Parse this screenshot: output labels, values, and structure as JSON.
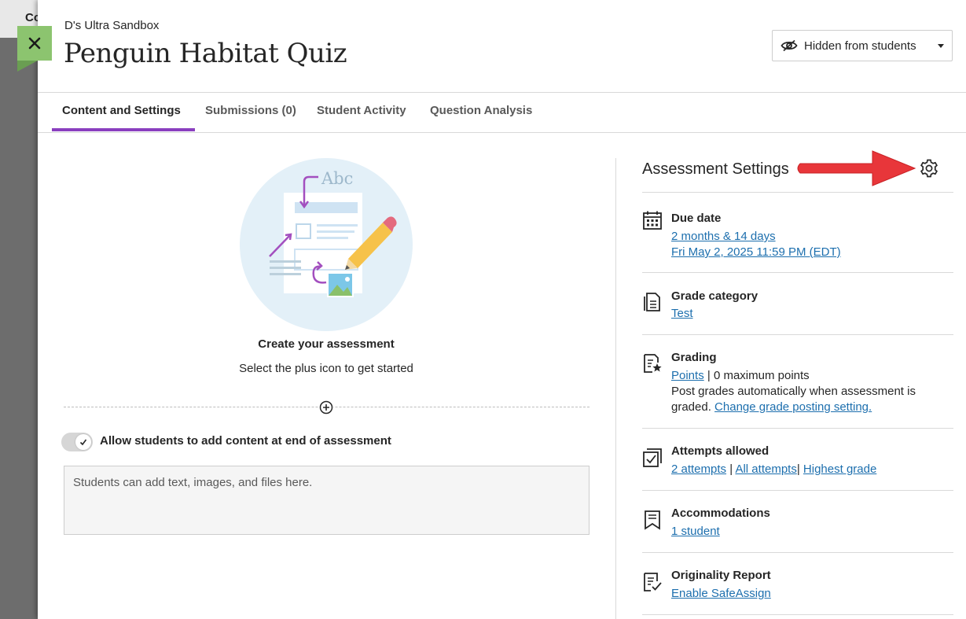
{
  "backdrop": {
    "partial_text": "Co"
  },
  "header": {
    "course_name": "D's Ultra Sandbox",
    "title": "Penguin Habitat Quiz",
    "visibility_label": "Hidden from students"
  },
  "tabs": [
    {
      "label": "Content and Settings",
      "active": true
    },
    {
      "label": "Submissions (0)",
      "active": false
    },
    {
      "label": "Student Activity",
      "active": false
    },
    {
      "label": "Question Analysis",
      "active": false
    }
  ],
  "main": {
    "illustration_text": "Abc",
    "create_title": "Create your assessment",
    "create_subtitle": "Select the plus icon to get started",
    "toggle_label": "Allow students to add content at end of assessment",
    "toggle_on": true,
    "content_placeholder": "Students can add text, images, and files here."
  },
  "settings": {
    "title": "Assessment Settings",
    "due_date": {
      "label": "Due date",
      "relative": "2 months & 14 days",
      "absolute": "Fri May 2, 2025 11:59 PM (EDT)"
    },
    "grade_category": {
      "label": "Grade category",
      "value": "Test"
    },
    "grading": {
      "label": "Grading",
      "points_link": "Points",
      "sep": "|",
      "max_points": "0 maximum points",
      "post_text_1": "Post grades automatically when assessment is",
      "post_text_2": "graded.",
      "change_link": "Change grade posting setting."
    },
    "attempts": {
      "label": "Attempts allowed",
      "count_link": "2 attempts",
      "sep1": "|",
      "all_link": "All attempts",
      "sep2": "|",
      "highest_link": "Highest grade"
    },
    "accommodations": {
      "label": "Accommodations",
      "value": "1 student"
    },
    "originality": {
      "label": "Originality Report",
      "value": "Enable SafeAssign"
    }
  },
  "colors": {
    "accent_purple": "#8a3fbf",
    "link_blue": "#1d6fae",
    "close_green": "#8cc46f",
    "annotation_red": "#e8363a"
  }
}
